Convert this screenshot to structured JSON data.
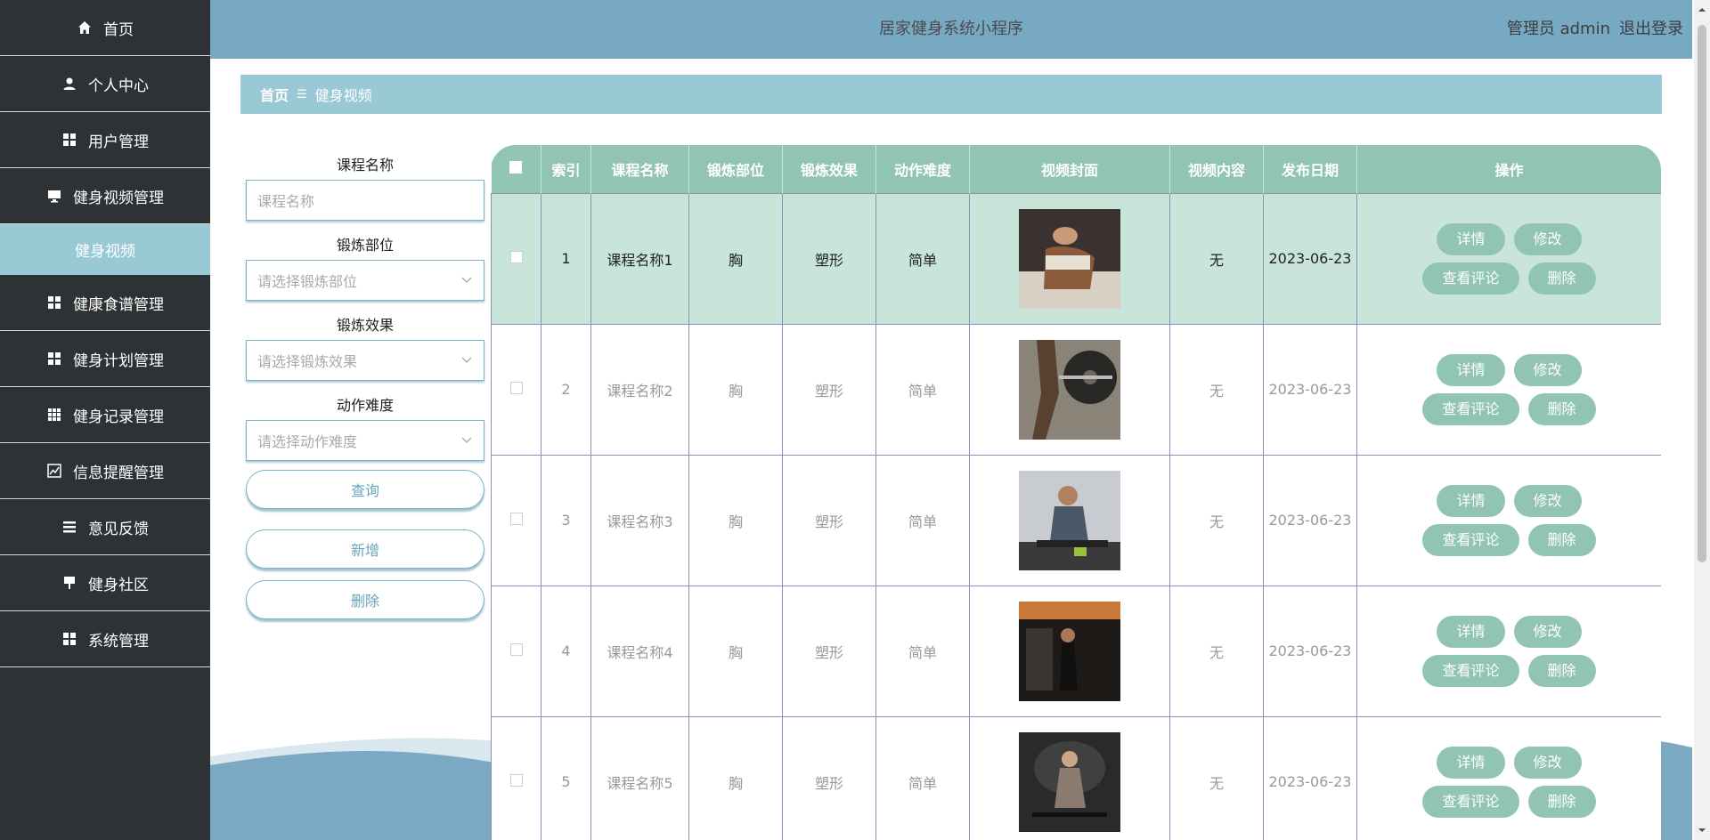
{
  "app": {
    "title": "居家健身系统小程序",
    "user": "管理员 admin",
    "logout": "退出登录"
  },
  "sidebar": {
    "items": [
      {
        "label": "首页",
        "icon": "home-icon"
      },
      {
        "label": "个人中心",
        "icon": "user-icon"
      },
      {
        "label": "用户管理",
        "icon": "grid-icon"
      },
      {
        "label": "健身视频管理",
        "icon": "monitor-icon"
      },
      {
        "label": "健身视频",
        "icon": ""
      },
      {
        "label": "健康食谱管理",
        "icon": "grid-icon"
      },
      {
        "label": "健身计划管理",
        "icon": "grid-icon"
      },
      {
        "label": "健身记录管理",
        "icon": "table-icon"
      },
      {
        "label": "信息提醒管理",
        "icon": "chart-icon"
      },
      {
        "label": "意见反馈",
        "icon": "list-icon"
      },
      {
        "label": "健身社区",
        "icon": "board-icon"
      },
      {
        "label": "系统管理",
        "icon": "grid-icon"
      }
    ]
  },
  "breadcrumb": {
    "home": "首页",
    "separator": "☰",
    "current": "健身视频"
  },
  "filters": {
    "course_label": "课程名称",
    "course_placeholder": "课程名称",
    "part_label": "锻炼部位",
    "part_placeholder": "请选择锻炼部位",
    "effect_label": "锻炼效果",
    "effect_placeholder": "请选择锻炼效果",
    "difficulty_label": "动作难度",
    "difficulty_placeholder": "请选择动作难度",
    "query": "查询",
    "add": "新增",
    "delete": "删除"
  },
  "table": {
    "headers": [
      "索引",
      "课程名称",
      "锻炼部位",
      "锻炼效果",
      "动作难度",
      "视频封面",
      "视频内容",
      "发布日期",
      "操作"
    ],
    "ops": {
      "detail": "详情",
      "edit": "修改",
      "comments": "查看评论",
      "delete": "删除"
    },
    "rows": [
      {
        "index": "1",
        "name": "课程名称1",
        "part": "胸",
        "effect": "塑形",
        "difficulty": "简单",
        "content": "无",
        "date": "2023-06-23"
      },
      {
        "index": "2",
        "name": "课程名称2",
        "part": "胸",
        "effect": "塑形",
        "difficulty": "简单",
        "content": "无",
        "date": "2023-06-23"
      },
      {
        "index": "3",
        "name": "课程名称3",
        "part": "胸",
        "effect": "塑形",
        "difficulty": "简单",
        "content": "无",
        "date": "2023-06-23"
      },
      {
        "index": "4",
        "name": "课程名称4",
        "part": "胸",
        "effect": "塑形",
        "difficulty": "简单",
        "content": "无",
        "date": "2023-06-23"
      },
      {
        "index": "5",
        "name": "课程名称5",
        "part": "胸",
        "effect": "塑形",
        "difficulty": "简单",
        "content": "无",
        "date": "2023-06-23"
      }
    ]
  },
  "colors": {
    "sidebar": "#2f3234",
    "header": "#78a9c2",
    "accent": "#9ac9d6",
    "button": "#91c5b1",
    "active_row": "#c9e5da"
  }
}
